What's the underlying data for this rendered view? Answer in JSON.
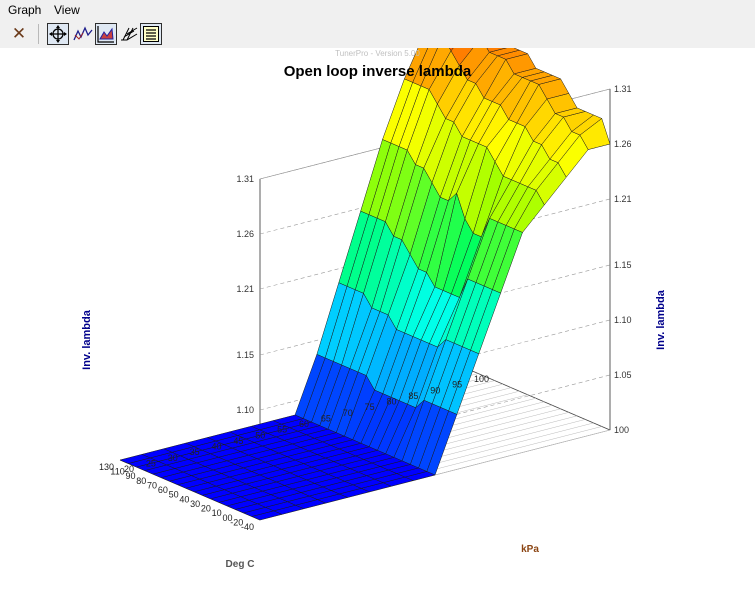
{
  "menu": {
    "graph": "Graph",
    "view": "View"
  },
  "toolbar": {
    "buttons": [
      {
        "icon": "close-x-icon"
      },
      {
        "icon": "crosshair-move-icon"
      },
      {
        "icon": "trace-icon"
      },
      {
        "icon": "surface-graph-icon",
        "pressed": true
      },
      {
        "icon": "wireframe-graph-icon"
      },
      {
        "icon": "table-lines-icon",
        "pressed": true
      }
    ]
  },
  "chart_data": {
    "type": "surface3d",
    "version_text": "TunerPro - Version 5.00",
    "title": "Open loop inverse lambda",
    "zlabel": "Inv. lambda",
    "xlabel": "Deg C",
    "ylabel": "kPa",
    "ztick_labels": [
      "1.05",
      "1.10",
      "1.15",
      "1.21",
      "1.26",
      "1.31"
    ],
    "ztick_values": [
      1.05,
      1.1,
      1.15,
      1.21,
      1.26,
      1.31
    ],
    "zlim": [
      1.0,
      1.31
    ],
    "x_values": [
      -40,
      -30,
      -20,
      -10,
      0,
      10,
      20,
      30,
      40,
      50,
      60,
      70,
      80,
      90,
      100,
      110,
      120,
      130
    ],
    "x_tick_labels": [
      "-40",
      "-20",
      "00",
      "10",
      "20",
      "30",
      "40",
      "50",
      "60",
      "70",
      "80",
      "90",
      "110",
      "130"
    ],
    "y_values": [
      20,
      25,
      30,
      35,
      40,
      45,
      50,
      55,
      60,
      65,
      70,
      75,
      80,
      85,
      90,
      95,
      100
    ],
    "y_tick_labels": [
      "20",
      "25",
      "30",
      "35",
      "40",
      "45",
      "50",
      "55",
      "60",
      "65",
      "70",
      "75",
      "80",
      "85",
      "90",
      "95",
      "100"
    ],
    "surface_values": [
      [
        1.0,
        1.0,
        1.0,
        1.0,
        1.0,
        1.0,
        1.0,
        1.0,
        1.0,
        1.05,
        1.1,
        1.15,
        1.2,
        1.22,
        1.24,
        1.26,
        1.26
      ],
      [
        1.0,
        1.0,
        1.0,
        1.0,
        1.0,
        1.0,
        1.0,
        1.0,
        1.0,
        1.05,
        1.1,
        1.15,
        1.2,
        1.23,
        1.25,
        1.27,
        1.28
      ],
      [
        1.0,
        1.0,
        1.0,
        1.0,
        1.0,
        1.0,
        1.0,
        1.0,
        1.0,
        1.05,
        1.1,
        1.15,
        1.2,
        1.23,
        1.25,
        1.27,
        1.28
      ],
      [
        1.0,
        1.0,
        1.0,
        1.0,
        1.0,
        1.0,
        1.0,
        1.0,
        1.0,
        1.05,
        1.1,
        1.15,
        1.2,
        1.23,
        1.26,
        1.28,
        1.28
      ],
      [
        1.0,
        1.0,
        1.0,
        1.0,
        1.0,
        1.0,
        1.0,
        1.0,
        1.0,
        1.05,
        1.1,
        1.15,
        1.2,
        1.23,
        1.26,
        1.28,
        1.28
      ],
      [
        1.0,
        1.0,
        1.0,
        1.0,
        1.0,
        1.0,
        1.0,
        1.0,
        1.0,
        1.04,
        1.09,
        1.13,
        1.18,
        1.23,
        1.27,
        1.29,
        1.29
      ],
      [
        1.0,
        1.0,
        1.0,
        1.0,
        1.0,
        1.0,
        1.0,
        1.0,
        1.0,
        1.04,
        1.09,
        1.13,
        1.18,
        1.24,
        1.27,
        1.3,
        1.3
      ],
      [
        1.0,
        1.0,
        1.0,
        1.0,
        1.0,
        1.0,
        1.0,
        1.0,
        1.0,
        1.04,
        1.09,
        1.13,
        1.19,
        1.25,
        1.27,
        1.3,
        1.3
      ],
      [
        1.0,
        1.0,
        1.0,
        1.0,
        1.0,
        1.0,
        1.0,
        1.0,
        1.0,
        1.04,
        1.09,
        1.13,
        1.21,
        1.25,
        1.28,
        1.3,
        1.3
      ],
      [
        1.0,
        1.0,
        1.0,
        1.0,
        1.0,
        1.0,
        1.0,
        1.0,
        1.0,
        1.04,
        1.09,
        1.14,
        1.2,
        1.25,
        1.28,
        1.3,
        1.3
      ],
      [
        1.0,
        1.0,
        1.0,
        1.0,
        1.0,
        1.0,
        1.0,
        1.0,
        1.0,
        1.04,
        1.09,
        1.14,
        1.2,
        1.25,
        1.28,
        1.31,
        1.31
      ],
      [
        1.0,
        1.0,
        1.0,
        1.0,
        1.0,
        1.0,
        1.0,
        1.0,
        1.0,
        1.05,
        1.1,
        1.15,
        1.21,
        1.26,
        1.29,
        1.31,
        1.31
      ],
      [
        1.0,
        1.0,
        1.0,
        1.0,
        1.0,
        1.0,
        1.0,
        1.0,
        1.0,
        1.05,
        1.1,
        1.16,
        1.22,
        1.26,
        1.29,
        1.31,
        1.31
      ],
      [
        1.0,
        1.0,
        1.0,
        1.0,
        1.0,
        1.0,
        1.0,
        1.0,
        1.0,
        1.05,
        1.1,
        1.16,
        1.22,
        1.27,
        1.3,
        1.32,
        1.32
      ],
      [
        1.0,
        1.0,
        1.0,
        1.0,
        1.0,
        1.0,
        1.0,
        1.0,
        1.0,
        1.05,
        1.11,
        1.17,
        1.23,
        1.28,
        1.31,
        1.33,
        1.34
      ],
      [
        1.0,
        1.0,
        1.0,
        1.0,
        1.0,
        1.0,
        1.0,
        1.0,
        1.0,
        1.05,
        1.11,
        1.17,
        1.23,
        1.28,
        1.32,
        1.34,
        1.35
      ],
      [
        1.0,
        1.0,
        1.0,
        1.0,
        1.0,
        1.0,
        1.0,
        1.0,
        1.0,
        1.05,
        1.11,
        1.17,
        1.23,
        1.28,
        1.32,
        1.35,
        1.36
      ],
      [
        1.0,
        1.0,
        1.0,
        1.0,
        1.0,
        1.0,
        1.0,
        1.0,
        1.0,
        1.05,
        1.11,
        1.17,
        1.23,
        1.28,
        1.32,
        1.35,
        1.36
      ]
    ],
    "colormap": [
      "#0000ff",
      "#0090ff",
      "#00ffff",
      "#00ff60",
      "#a0ff00",
      "#ffff00",
      "#ff9000",
      "#ff0000"
    ],
    "grid": true,
    "axis_label_color": "#00008b",
    "xy_label_color": "#8b4513"
  }
}
